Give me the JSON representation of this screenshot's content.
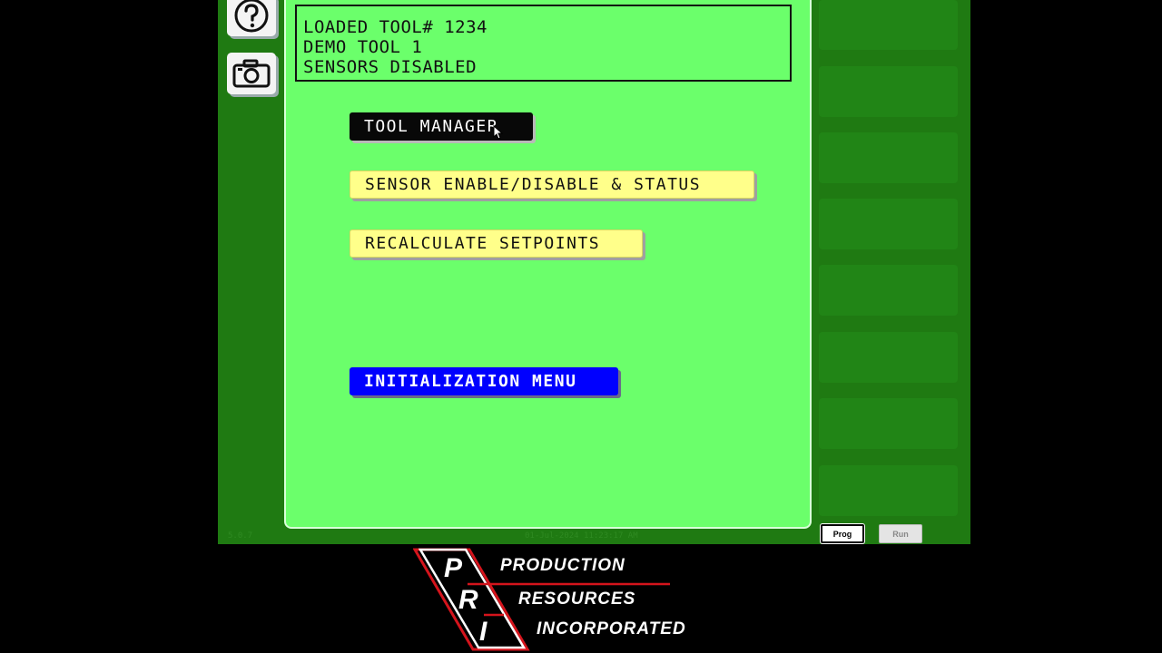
{
  "status": {
    "line1": "LOADED TOOL# 1234",
    "line2": "DEMO TOOL 1",
    "line3": "SENSORS DISABLED"
  },
  "menu": {
    "tool_manager": "TOOL MANAGER",
    "sensor_enable": "SENSOR ENABLE/DISABLE & STATUS",
    "recalculate": "RECALCULATE SETPOINTS",
    "initialization": "INITIALIZATION MENU"
  },
  "footer": {
    "version": "5.0.7",
    "datetime": "01-Jul-2024 11:23:17 AM",
    "prog_label": "Prog",
    "run_label": "Run"
  },
  "logo": {
    "letters": [
      "P",
      "R",
      "I"
    ],
    "line1": "PRODUCTION",
    "line2": "RESOURCES",
    "line3": "INCORPORATED"
  },
  "icons": {
    "help": "question-mark-icon",
    "camera": "camera-icon"
  },
  "colors": {
    "panel": "#6bff6b",
    "frame": "#1f7a12",
    "button_black": "#080808",
    "button_yellow": "#ffff8a",
    "button_blue": "#0000ff",
    "logo_red": "#d4141c"
  }
}
